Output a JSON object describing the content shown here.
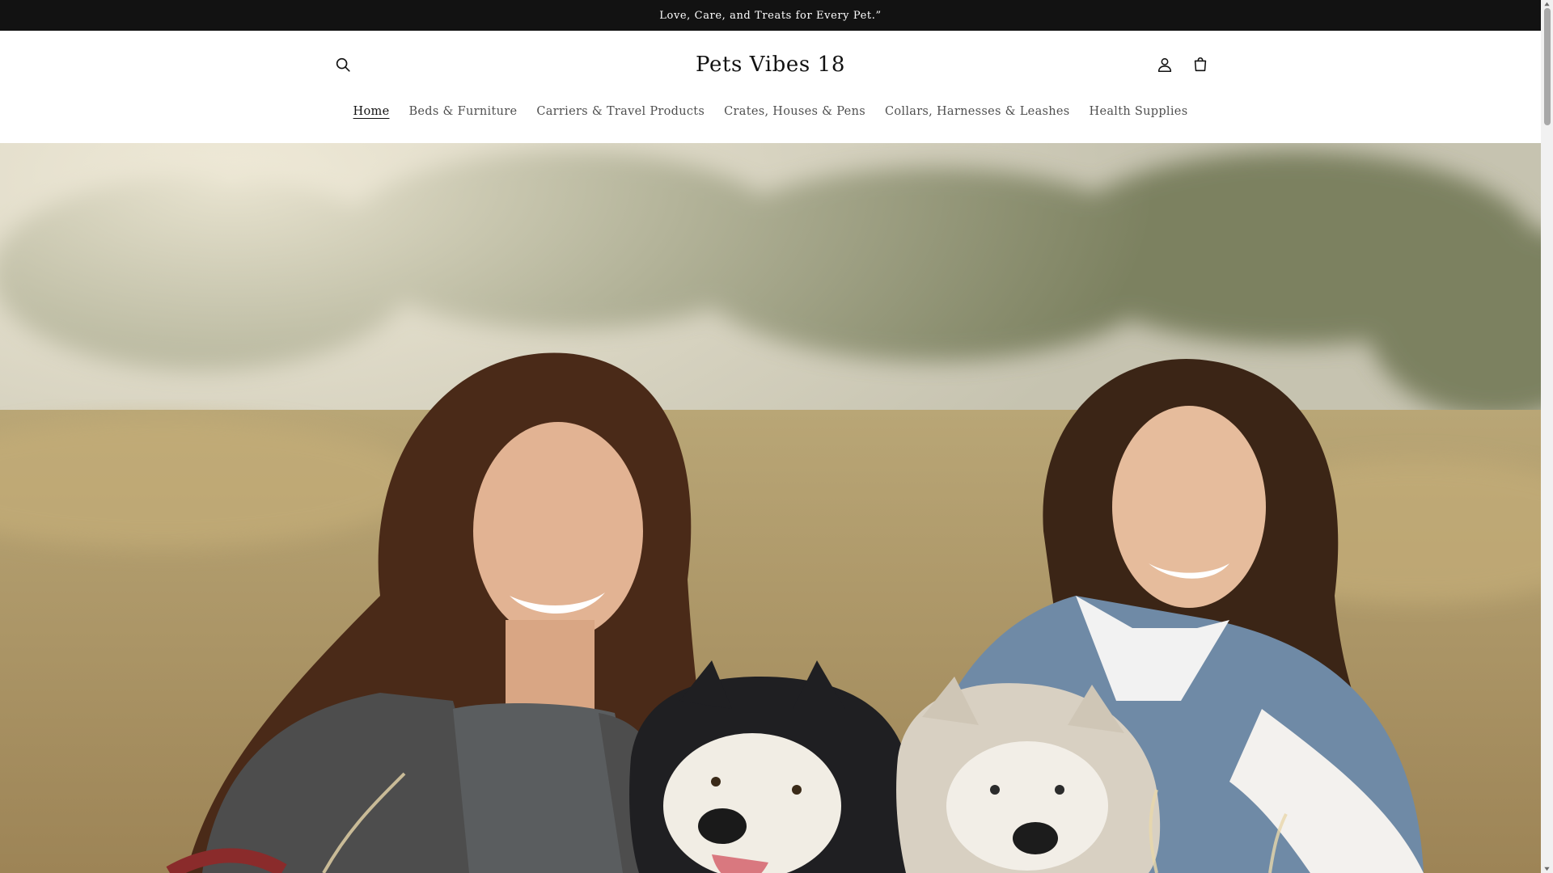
{
  "announcement": {
    "text": "Love, Care, and Treats for Every Pet.”"
  },
  "header": {
    "logo": "Pets Vibes 18",
    "icons": {
      "search": "search-icon",
      "account": "account-icon",
      "cart": "cart-icon"
    }
  },
  "nav": {
    "items": [
      {
        "label": "Home",
        "active": true
      },
      {
        "label": "Beds & Furniture"
      },
      {
        "label": "Carriers & Travel Products"
      },
      {
        "label": "Crates, Houses & Pens"
      },
      {
        "label": "Collars, Harnesses & Leashes"
      },
      {
        "label": "Health Supplies"
      }
    ]
  },
  "colors": {
    "text": "#121212",
    "announcement_bg": "#121212",
    "background": "#ffffff"
  }
}
